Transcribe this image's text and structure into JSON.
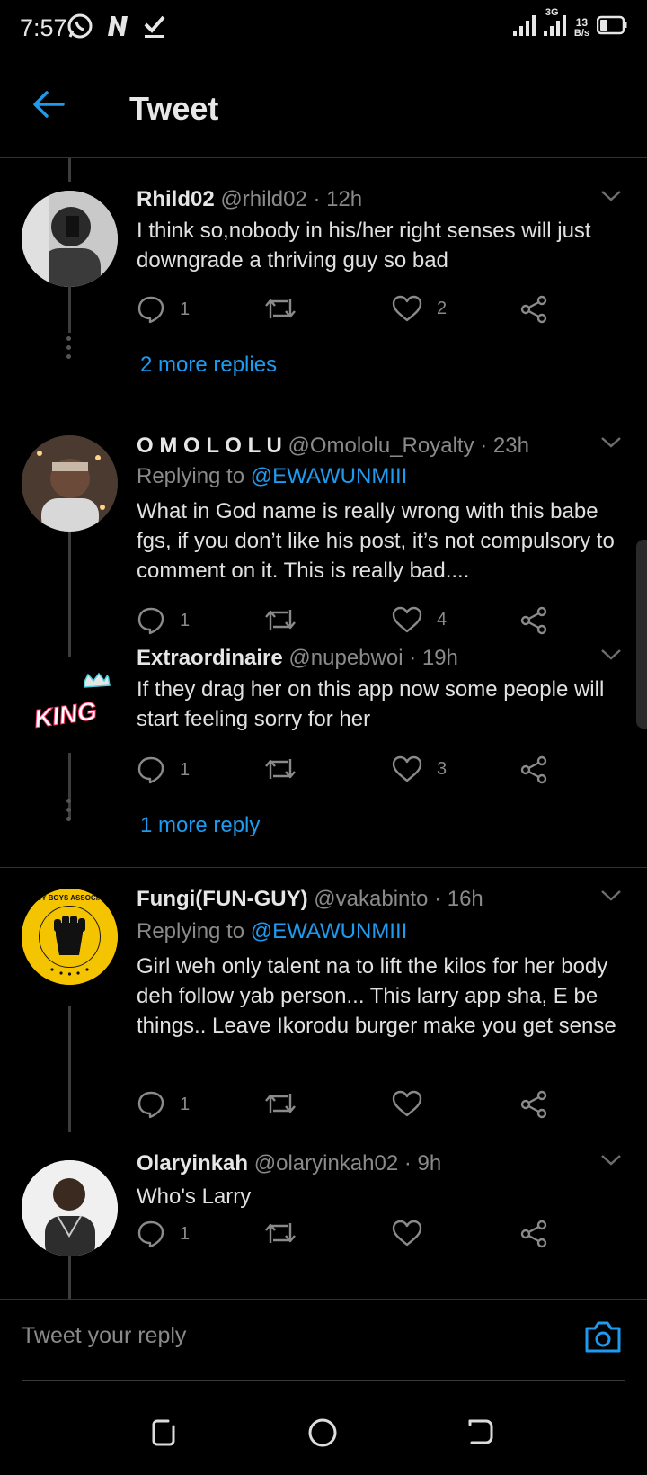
{
  "status_bar": {
    "time": "7:57",
    "net_type": "3G",
    "speed": "13",
    "speed_unit": "B/s"
  },
  "header": {
    "title": "Tweet",
    "accent": "#1d9bf0"
  },
  "tweets": [
    {
      "name": "Rhild02",
      "handle": "@rhild02 · 12h",
      "body": "I think so,nobody in his/her right senses will just downgrade a thriving guy so bad",
      "replies": "1",
      "retweets": "",
      "likes": "2",
      "more": "2 more replies"
    },
    {
      "name": "O M O L O L U",
      "handle": "@Omololu_Royalty · 23h",
      "replying_label": "Replying to",
      "replying_to": "@EWAWUNMIII",
      "body": "What in God name is really wrong with this babe fgs, if you don’t like his post, it’s not compulsory to comment on it. This is really bad....",
      "replies": "1",
      "retweets": "",
      "likes": "4"
    },
    {
      "name": "Extraordinaire",
      "handle": "@nupebwoi · 19h",
      "avatar_text": "KING",
      "body": "If they drag her on this app now some people will start feeling sorry for her",
      "replies": "1",
      "retweets": "",
      "likes": "3",
      "more": "1 more reply"
    },
    {
      "name": "Fungi(FUN-GUY)",
      "handle": "@vakabinto · 16h",
      "avatar_text": "STINGY BOYS ASSOCIATION",
      "replying_label": "Replying to",
      "replying_to": "@EWAWUNMIII",
      "body": "Girl weh only talent na to lift the kilos for her body deh follow yab person... This larry app sha, E be things.. Leave Ikorodu burger make you get sense",
      "replies": "1",
      "retweets": "",
      "likes": ""
    },
    {
      "name": "Olaryinkah",
      "handle": "@olaryinkah02 · 9h",
      "body": "Who's Larry",
      "replies": "1",
      "retweets": "",
      "likes": ""
    }
  ],
  "reply_bar": {
    "placeholder": "Tweet your reply"
  },
  "icons": {
    "back": "arrow-left-icon",
    "reply": "speech-bubble-icon",
    "retweet": "retweet-icon",
    "like": "heart-icon",
    "share": "share-icon",
    "more": "chevron-down-icon",
    "camera": "camera-icon"
  }
}
